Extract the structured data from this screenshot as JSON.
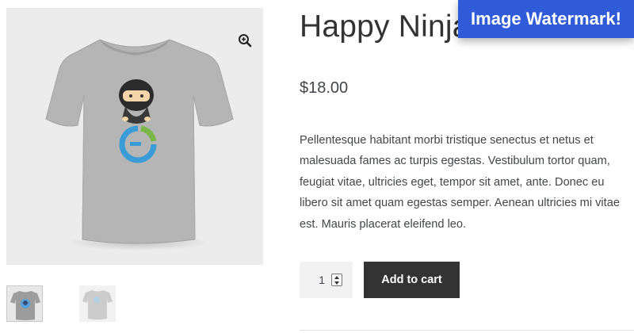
{
  "product": {
    "title": "Happy Ninja",
    "price": "$18.00",
    "description": "Pellentesque habitant morbi tristique senectus et netus et malesuada fames ac turpis egestas. Vestibulum tortor quam, feugiat vitae, ultricies eget, tempor sit amet, ante. Donec eu libero sit amet quam egestas semper. Aenean ultricies mi vitae est. Mauris placerat eleifend leo."
  },
  "cart": {
    "quantity": "1",
    "add_label": "Add to cart"
  },
  "watermark": {
    "text": "Image Watermark!",
    "color": "#2f5bd8"
  },
  "gallery": {
    "zoom_icon": "magnifier-plus-icon",
    "thumbnails": [
      "ninja-tshirt-front",
      "ninja-tshirt-back"
    ]
  },
  "colors": {
    "button_bg": "#333333",
    "shirt": "#b5b5b5",
    "logo_blue": "#3b9bd6",
    "logo_green": "#7ab648"
  }
}
